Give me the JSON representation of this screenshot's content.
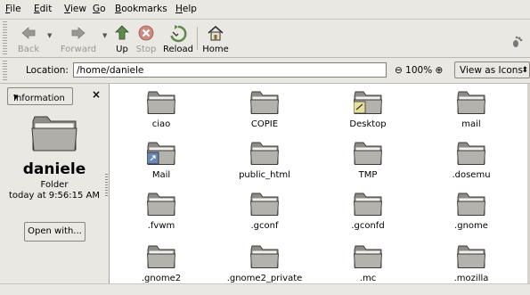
{
  "menu": {
    "file": "File",
    "edit": "Edit",
    "view": "View",
    "go": "Go",
    "bookmarks": "Bookmarks",
    "help": "Help"
  },
  "toolbar": {
    "back": "Back",
    "forward": "Forward",
    "up": "Up",
    "stop": "Stop",
    "reload": "Reload",
    "home": "Home"
  },
  "location": {
    "label": "Location:",
    "path": "/home/daniele",
    "zoom": "100%",
    "view_mode": "View as Icons"
  },
  "sidebar": {
    "selector": "Information",
    "name": "daniele",
    "type": "Folder",
    "date": "today at 9:56:15 AM",
    "open_with": "Open with..."
  },
  "files": [
    {
      "name": "ciao"
    },
    {
      "name": "COPIE"
    },
    {
      "name": "Desktop",
      "emblem": "note"
    },
    {
      "name": "mail"
    },
    {
      "name": "Mail",
      "emblem": "link"
    },
    {
      "name": "public_html"
    },
    {
      "name": "TMP"
    },
    {
      "name": ".dosemu"
    },
    {
      "name": ".fvwm"
    },
    {
      "name": ".gconf"
    },
    {
      "name": ".gconfd"
    },
    {
      "name": ".gnome"
    },
    {
      "name": ".gnome2"
    },
    {
      "name": ".gnome2_private"
    },
    {
      "name": ".mc"
    },
    {
      "name": ".mozilla"
    }
  ]
}
